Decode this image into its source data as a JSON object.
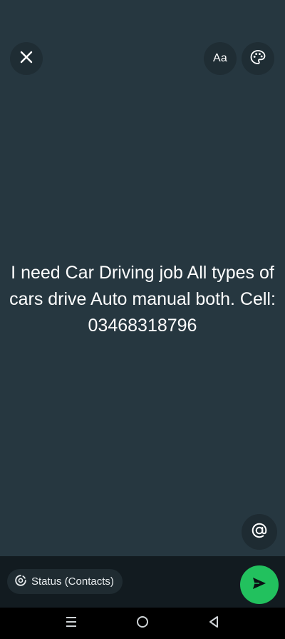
{
  "toolbar": {
    "close_icon": "close-icon",
    "font_label": "Aa",
    "palette_icon": "palette-icon"
  },
  "status": {
    "text": "I need Car Driving job All types of cars drive Auto manual both. Cell: 03468318796"
  },
  "mention": {
    "icon": "at-icon"
  },
  "bottom_bar": {
    "audience_label": "Status (Contacts)",
    "audience_icon": "status-icon",
    "send_icon": "send-icon"
  },
  "nav": {
    "recents_icon": "recents-icon",
    "home_icon": "home-icon",
    "back_icon": "back-icon"
  },
  "colors": {
    "background": "#263740",
    "accent": "#22c15e",
    "bottom_bar": "#121b20",
    "text": "#ffffff"
  }
}
